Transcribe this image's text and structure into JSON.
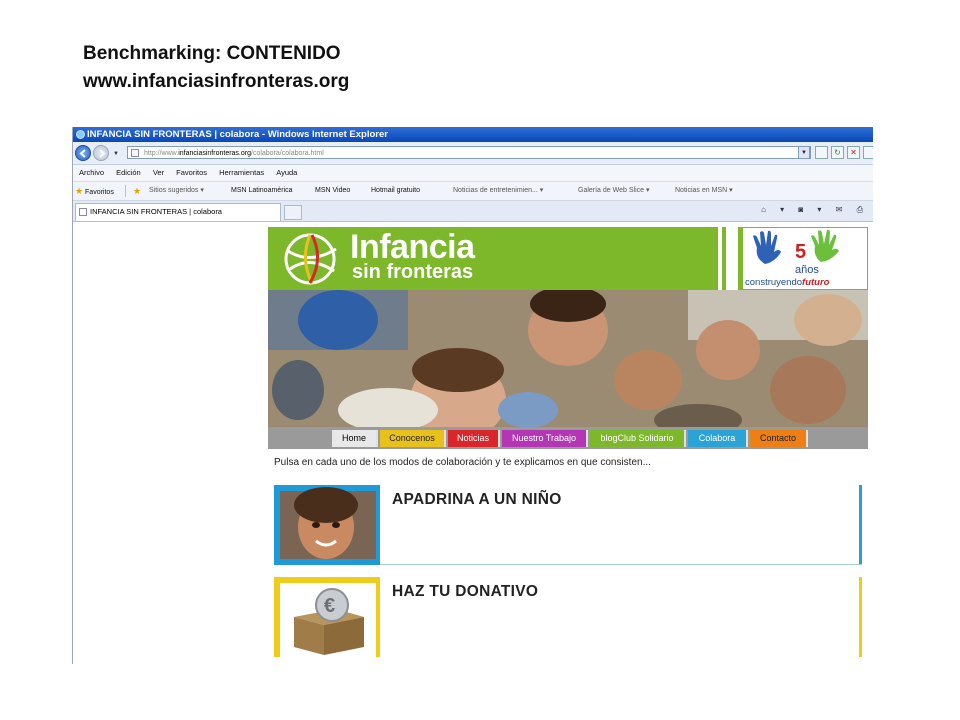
{
  "slide": {
    "title_line1": "Benchmarking:  CONTENIDO",
    "title_line2": "www.infanciasinfronteras.org"
  },
  "browser": {
    "window_title": "INFANCIA SIN FRONTERAS | colabora - Windows Internet Explorer",
    "address_prefix": "http://www.",
    "address_domain": "infanciasinfronteras.org",
    "address_path": "/colabora/colabora.html",
    "menu": [
      "Archivo",
      "Edición",
      "Ver",
      "Favoritos",
      "Herramientas",
      "Ayuda"
    ],
    "favorites_label": "Favoritos",
    "favorites": [
      "Sitios sugeridos ▾",
      "MSN Latinoamérica",
      "MSN Video",
      "Hotmail gratuito",
      "Noticias de entretenimien... ▾",
      "Galería de Web Slice ▾",
      "Noticias en MSN ▾"
    ],
    "tab_title": "INFANCIA SIN FRONTERAS | colabora"
  },
  "site": {
    "logo_main": "Infancia",
    "logo_sub": "sin fronteras",
    "anniv_years": "años",
    "anniv_slogan_a": "construyendo",
    "anniv_slogan_b": "futuro",
    "nav": [
      {
        "label": "Home",
        "color": "#e8e8e8"
      },
      {
        "label": "Conocenos",
        "color": "#e8c21a"
      },
      {
        "label": "Noticias",
        "color": "#d8262b"
      },
      {
        "label": "Nuestro Trabajo",
        "color": "#b436b4"
      },
      {
        "label": "blogClub Solidario",
        "color": "#7cb829"
      },
      {
        "label": "Colabora",
        "color": "#2aa3d6"
      },
      {
        "label": "Contacto",
        "color": "#ee7f14"
      }
    ],
    "intro": "Pulsa en cada uno de los modos de colaboración y te explicamos en que consisten...",
    "cards": [
      {
        "title": "APADRINA A UN NIÑO",
        "accent": "#2a9ed8"
      },
      {
        "title": "HAZ TU DONATIVO",
        "accent": "#f0cc1a"
      }
    ]
  }
}
